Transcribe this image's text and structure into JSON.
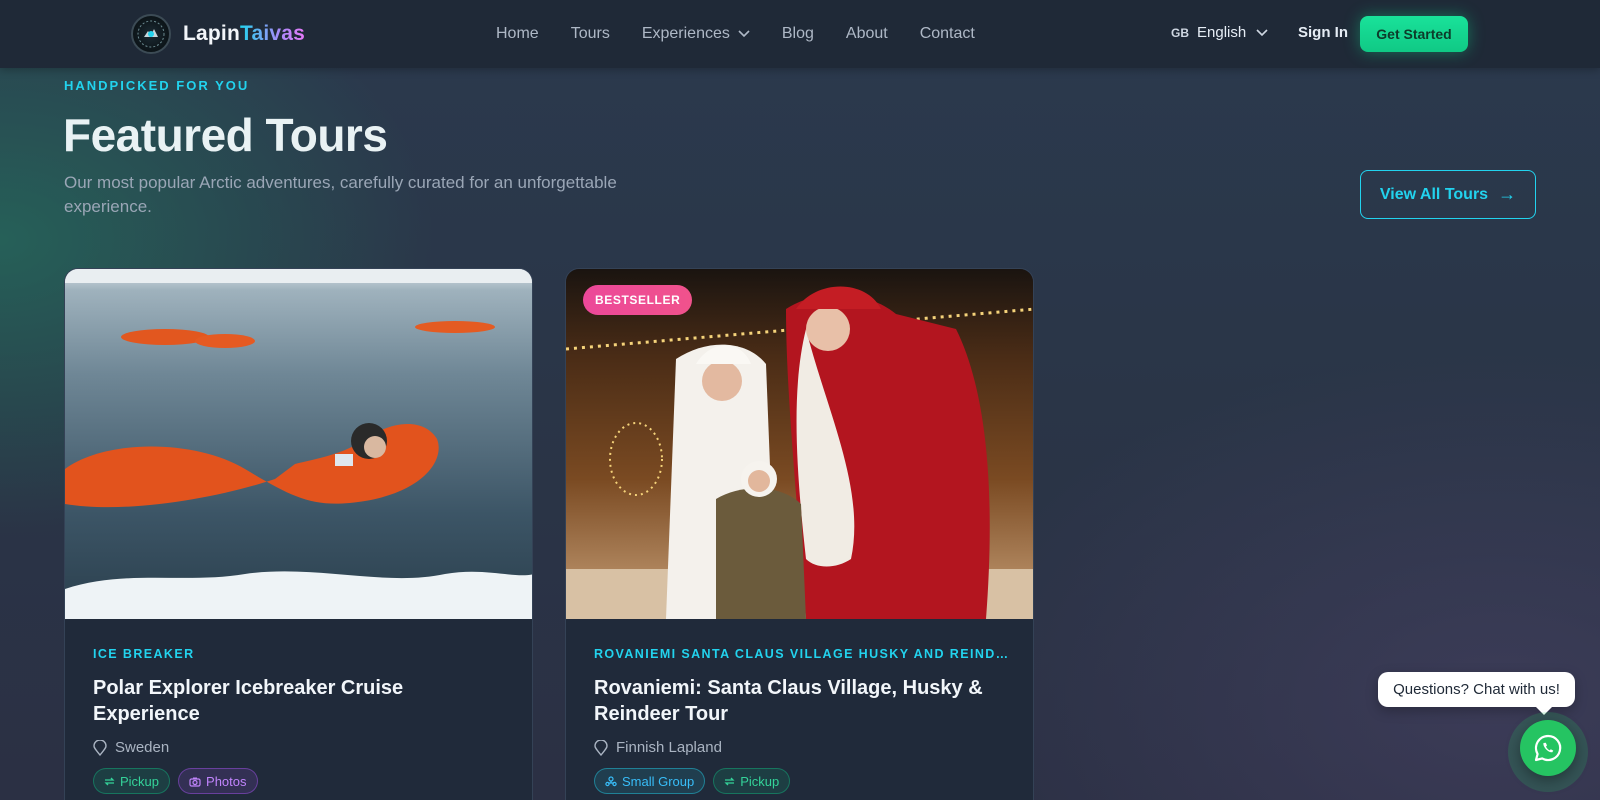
{
  "header": {
    "logo_part1": "Lapin",
    "logo_part2": "Taivas",
    "nav": [
      {
        "label": "Home"
      },
      {
        "label": "Tours"
      },
      {
        "label": "Experiences"
      },
      {
        "label": "Blog"
      },
      {
        "label": "About"
      },
      {
        "label": "Contact"
      }
    ],
    "language_code": "GB",
    "language": "English",
    "sign_in": "Sign In",
    "cta": "Get Started"
  },
  "section": {
    "eyebrow": "HANDPICKED FOR YOU",
    "title": "Featured Tours",
    "subtitle": "Our most popular Arctic adventures, carefully curated for an unforgettable experience.",
    "view_all": "View All Tours",
    "view_all_arrow": "→"
  },
  "tours": [
    {
      "badge": "",
      "category": "ICE BREAKER",
      "title": "Polar Explorer Icebreaker Cruise Experience",
      "location": "Sweden",
      "tags": [
        {
          "label": "Pickup",
          "icon": "pickup-icon"
        },
        {
          "label": "Photos",
          "icon": "camera-icon"
        }
      ]
    },
    {
      "badge": "BESTSELLER",
      "category": "ROVANIEMI SANTA CLAUS VILLAGE HUSKY AND REINDEER TOUR",
      "title": "Rovaniemi: Santa Claus Village, Husky & Reindeer Tour",
      "location": "Finnish Lapland",
      "tags": [
        {
          "label": "Small Group",
          "icon": "group-icon"
        },
        {
          "label": "Pickup",
          "icon": "pickup-icon"
        }
      ]
    }
  ],
  "chat": {
    "prompt": "Questions? Chat with us!",
    "icon": "whatsapp-icon"
  },
  "colors": {
    "accent": "#22d3ee",
    "cta": "#10c985",
    "badge": "#ec4899",
    "whatsapp": "#25c462"
  }
}
